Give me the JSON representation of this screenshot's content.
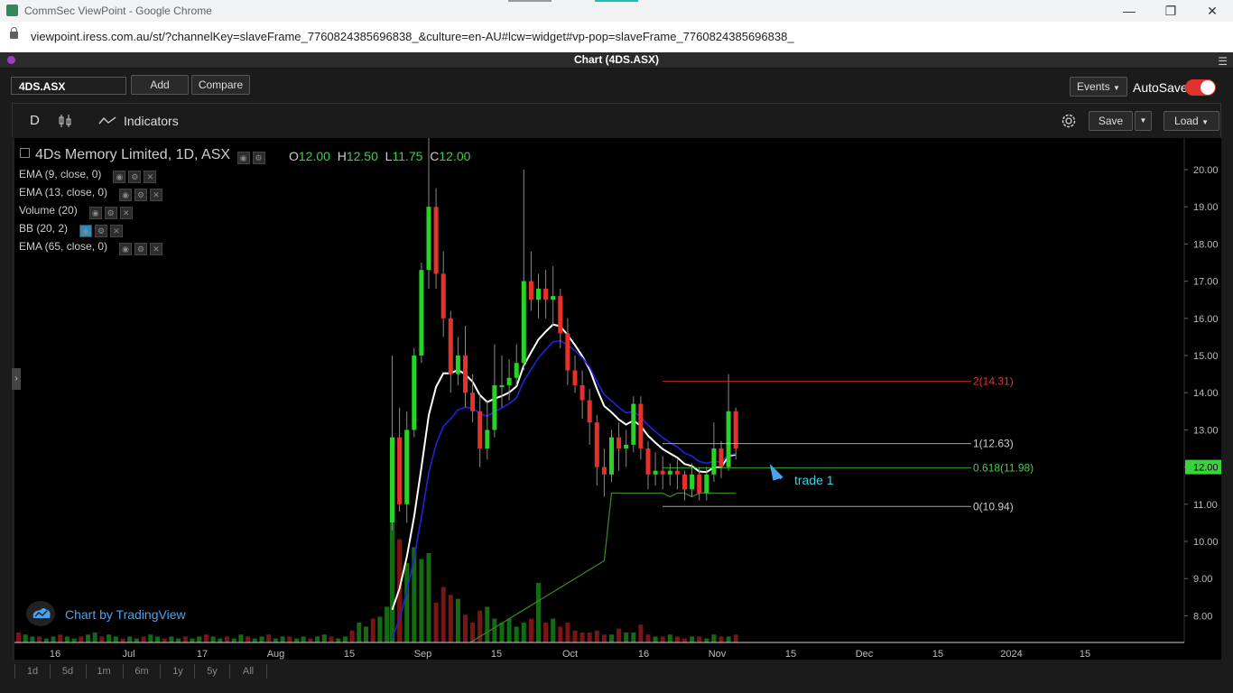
{
  "browser": {
    "title": "CommSec ViewPoint - Google Chrome",
    "url": "viewpoint.iress.com.au/st/?channelKey=slaveFrame_7760824385696838_&culture=en-AU#lcw=widget#vp-pop=slaveFrame_7760824385696838_"
  },
  "window": {
    "title": "Chart (4DS.ASX)"
  },
  "topbar": {
    "symbol": "4DS.ASX",
    "add_label": "Add",
    "compare_label": "Compare",
    "events_label": "Events",
    "autosave_label": "AutoSave"
  },
  "toolbar": {
    "interval": "D",
    "indicators_label": "Indicators",
    "save_label": "Save",
    "load_label": "Load"
  },
  "legend": {
    "title": "4Ds Memory Limited, 1D, ASX",
    "o_label": "O",
    "o_value": "12.00",
    "h_label": "H",
    "h_value": "12.50",
    "l_label": "L",
    "l_value": "11.75",
    "c_label": "C",
    "c_value": "12.00",
    "indicators": [
      "EMA (9, close, 0)",
      "EMA (13, close, 0)",
      "Volume (20)",
      "BB (20, 2)",
      "EMA (65, close, 0)"
    ]
  },
  "branding": {
    "text": "Chart by TradingView"
  },
  "annotation": {
    "text": "trade 1"
  },
  "timeframes": [
    "1d",
    "5d",
    "1m",
    "6m",
    "1y",
    "5y",
    "All"
  ],
  "colors": {
    "up": "#27d327",
    "down": "#e8302b",
    "ema_fast": "#ffffff",
    "ema_slow": "#2222dd",
    "ema_long": "#3a8a24",
    "accent": "#3bd33b"
  },
  "chart_data": {
    "type": "candlestick",
    "price_axis": {
      "ticks": [
        "20.00",
        "19.00",
        "18.00",
        "17.00",
        "16.00",
        "15.00",
        "14.00",
        "13.00",
        "12.00",
        "11.00",
        "10.00",
        "9.00",
        "8.00"
      ],
      "last_price": "12.00"
    },
    "time_axis": {
      "ticks": [
        "16",
        "Jul",
        "17",
        "Aug",
        "15",
        "Sep",
        "15",
        "Oct",
        "16",
        "Nov",
        "15",
        "Dec",
        "15",
        "2024",
        "15"
      ]
    },
    "fib_levels": [
      {
        "label": "2(14.31)",
        "value": 14.31,
        "color": "#e8302b"
      },
      {
        "label": "1(12.63)",
        "value": 12.63,
        "color": "#cccccc"
      },
      {
        "label": "0.618(11.98)",
        "value": 11.98,
        "color": "#3bd33b"
      },
      {
        "label": "0(10.94)",
        "value": 10.94,
        "color": "#cccccc"
      }
    ],
    "candles": [
      [
        10.5,
        12.8,
        10.3,
        15.0,
        10.0
      ],
      [
        12.8,
        11.0,
        10.8,
        13.6,
        9.8
      ],
      [
        11.0,
        13.0,
        10.5,
        13.5,
        10.6
      ],
      [
        13.0,
        15.0,
        12.8,
        15.2,
        14.4
      ],
      [
        15.0,
        17.3,
        14.8,
        17.5,
        17.2
      ],
      [
        17.3,
        19.0,
        16.8,
        21.0,
        20.3
      ],
      [
        19.0,
        17.2,
        16.8,
        19.5,
        18.0
      ],
      [
        17.2,
        16.0,
        15.5,
        17.8,
        15.5
      ],
      [
        16.0,
        14.5,
        14.0,
        16.2,
        14.4
      ],
      [
        14.5,
        15.0,
        14.2,
        15.5,
        14.7
      ],
      [
        15.0,
        14.0,
        13.6,
        15.8,
        14.2
      ],
      [
        14.0,
        13.5,
        13.2,
        14.5,
        13.0
      ],
      [
        13.5,
        12.5,
        12.0,
        14.0,
        12.5
      ],
      [
        12.5,
        13.0,
        12.2,
        13.8,
        11.8
      ],
      [
        13.0,
        14.2,
        12.8,
        15.3,
        14.4
      ],
      [
        14.2,
        14.2,
        13.6,
        15.0,
        15.5
      ],
      [
        14.2,
        14.4,
        13.8,
        14.9,
        13.9
      ],
      [
        14.4,
        14.8,
        14.2,
        15.3,
        14.6
      ],
      [
        14.8,
        17.0,
        14.6,
        20.0,
        20.3
      ],
      [
        17.0,
        16.5,
        16.2,
        17.8,
        19.4
      ],
      [
        16.5,
        16.8,
        16.0,
        17.2,
        17.2
      ],
      [
        16.8,
        16.5,
        16.0,
        17.3,
        16.1
      ],
      [
        16.5,
        16.6,
        15.8,
        17.4,
        15.4
      ],
      [
        16.6,
        15.6,
        15.2,
        16.8,
        15.1
      ],
      [
        15.6,
        14.6,
        14.2,
        16.0,
        14.0
      ],
      [
        14.6,
        14.2,
        14.0,
        15.0,
        13.2
      ],
      [
        14.2,
        13.8,
        13.3,
        14.6,
        13.2
      ],
      [
        13.8,
        13.2,
        12.6,
        14.1,
        12.7
      ],
      [
        13.2,
        12.0,
        11.5,
        13.4,
        12.1
      ],
      [
        12.0,
        11.8,
        11.2,
        12.5,
        11.8
      ],
      [
        11.8,
        12.8,
        11.6,
        13.0,
        12.3
      ],
      [
        12.8,
        12.5,
        11.9,
        13.2,
        11.6
      ],
      [
        12.5,
        12.6,
        12.0,
        13.0,
        11.5
      ],
      [
        12.6,
        13.7,
        12.4,
        13.9,
        11.4
      ],
      [
        13.7,
        12.5,
        12.2,
        13.9,
        11.4
      ],
      [
        12.5,
        11.8,
        11.4,
        12.7,
        11.3
      ],
      [
        11.8,
        11.9,
        11.5,
        12.4,
        11.6
      ],
      [
        11.9,
        11.8,
        11.4,
        12.3,
        11.3
      ],
      [
        11.8,
        11.9,
        11.5,
        12.1,
        11.2
      ],
      [
        11.9,
        11.8,
        11.4,
        12.2,
        11.3
      ],
      [
        11.8,
        11.4,
        11.1,
        11.9,
        11.6
      ],
      [
        11.4,
        11.8,
        11.2,
        12.1,
        11.2
      ],
      [
        11.8,
        11.3,
        11.1,
        12.0,
        11.3
      ],
      [
        11.3,
        11.8,
        11.1,
        12.0,
        11.4
      ],
      [
        11.8,
        12.5,
        11.6,
        13.2,
        11.6
      ],
      [
        12.5,
        12.0,
        11.7,
        12.7,
        11.3
      ],
      [
        12.0,
        13.5,
        11.9,
        14.5,
        12.1
      ],
      [
        13.5,
        12.5,
        12.2,
        13.6,
        11.9
      ]
    ],
    "volumes_start": [
      5,
      4,
      3,
      3,
      2,
      3,
      4,
      3,
      2,
      3,
      4,
      5,
      3,
      4,
      3,
      2,
      3,
      2,
      3,
      4,
      3,
      2,
      3,
      2,
      3,
      2,
      3,
      4,
      3,
      2,
      3,
      2,
      4,
      3,
      2,
      3,
      4,
      2,
      3,
      3,
      2,
      3,
      2,
      3,
      4,
      3,
      2,
      3,
      6,
      10,
      8,
      12,
      13,
      18
    ],
    "volumes": [
      60,
      52,
      40,
      48,
      42,
      45,
      20,
      28,
      24,
      22,
      14,
      10,
      16,
      18,
      12,
      10,
      12,
      8,
      10,
      12,
      30,
      10,
      12,
      8,
      10,
      6,
      5,
      5,
      6,
      4,
      4,
      7,
      5,
      5,
      9,
      4,
      3,
      3,
      4,
      3,
      2,
      3,
      3,
      2,
      4,
      3,
      3,
      4
    ]
  }
}
